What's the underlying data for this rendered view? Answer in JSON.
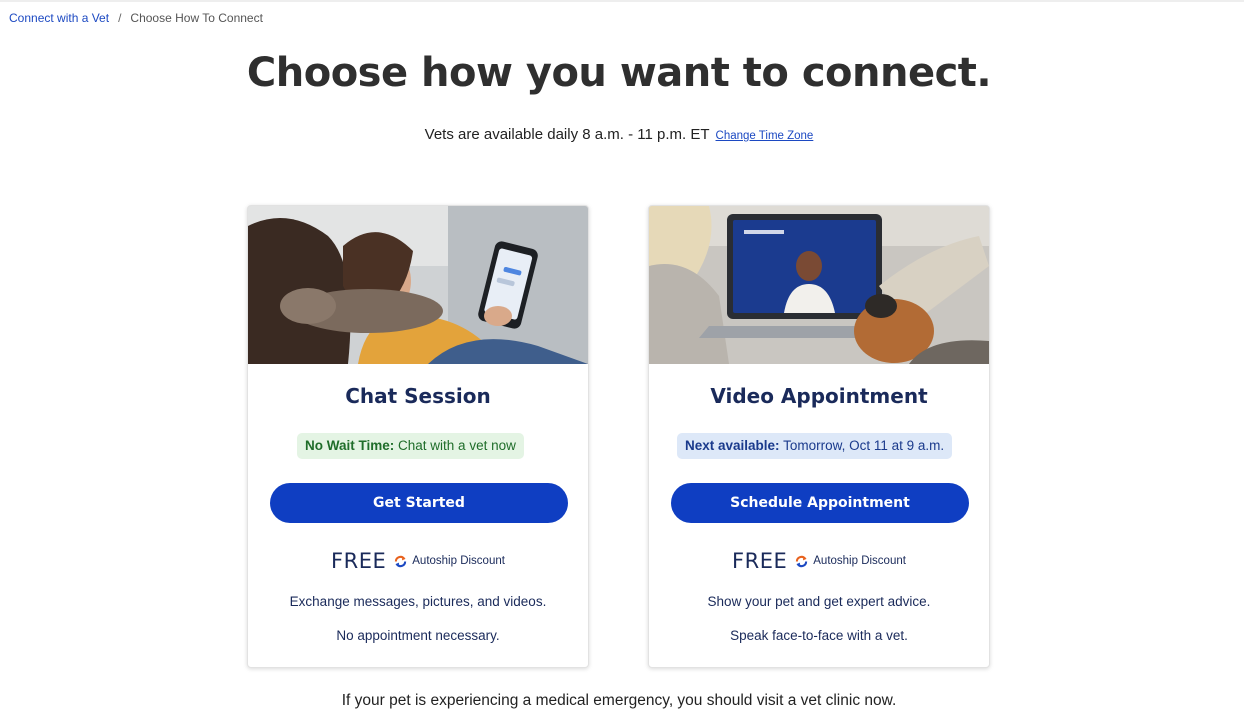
{
  "breadcrumb": {
    "parent": "Connect with a Vet",
    "separator": "/",
    "current": "Choose How To Connect"
  },
  "header": {
    "title": "Choose how you want to connect.",
    "availability": "Vets are available daily 8 a.m. - 11 p.m. ET",
    "change_time_zone": "Change Time Zone"
  },
  "cards": [
    {
      "title": "Chat Session",
      "status_label": "No Wait Time:",
      "status_value": "Chat with a vet now",
      "button_label": "Get Started",
      "price": "FREE",
      "discount_label": "Autoship Discount",
      "description_1": "Exchange messages, pictures, and videos.",
      "description_2": "No appointment necessary."
    },
    {
      "title": "Video Appointment",
      "status_label": "Next available:",
      "status_value": "Tomorrow, Oct 11 at 9 a.m.",
      "button_label": "Schedule Appointment",
      "price": "FREE",
      "discount_label": "Autoship Discount",
      "description_1": "Show your pet and get expert advice.",
      "description_2": "Speak face-to-face with a vet."
    }
  ],
  "footer": {
    "emergency_note": "If your pet is experiencing a medical emergency, you should visit a vet clinic now."
  },
  "colors": {
    "brand_blue": "#0f3ec2",
    "link_blue": "#1c49c2",
    "navy_text": "#1a2a5a",
    "green_pill_bg": "#e4f4e4",
    "blue_pill_bg": "#dde8f8",
    "autoship_orange": "#e8621e"
  },
  "icons": {
    "autoship": "autoship-refresh-icon"
  }
}
